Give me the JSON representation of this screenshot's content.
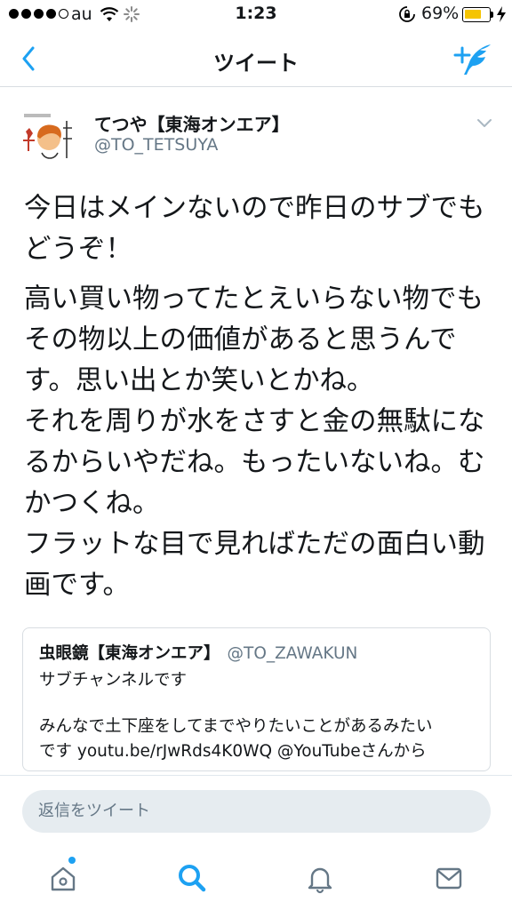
{
  "status": {
    "carrier": "au",
    "time": "1:23",
    "battery": "69%",
    "battery_level": 0.69
  },
  "nav": {
    "title": "ツイート"
  },
  "tweet": {
    "display_name": "てつや【東海オンエア】",
    "handle": "@TO_TETSUYA",
    "paragraphs": [
      "今日はメインないので昨日のサブでも\nどうぞ！",
      "高い買い物ってたとえいらない物でも\nその物以上の価値があると思うんで\nす。思い出とか笑いとかね。\nそれを周りが水をさすと金の無駄にな\nるからいやだね。もったいないね。む\nかつくね。\nフラットな目で見ればただの面白い動\n画です。"
    ]
  },
  "quote": {
    "display_name": "虫眼鏡【東海オンエア】",
    "handle": "@TO_ZAWAKUN",
    "line1": "サブチャンネルです",
    "line2": "みんなで土下座をしてまでやりたいことがあるみたい",
    "line3": "です youtu.be/rJwRds4K0WQ @YouTubeさんから"
  },
  "reply": {
    "placeholder": "返信をツイート"
  },
  "colors": {
    "accent": "#1da1f2",
    "text": "#14171a",
    "muted": "#657786"
  },
  "icons": {
    "tabs": [
      "home-icon",
      "search-icon",
      "bell-icon",
      "mail-icon"
    ]
  }
}
